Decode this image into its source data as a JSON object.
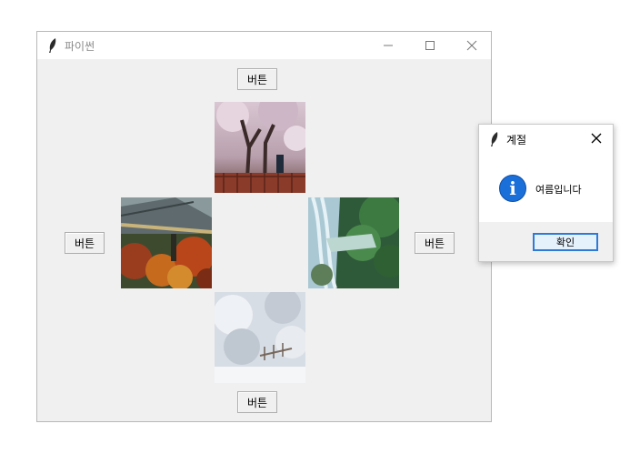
{
  "main_window": {
    "title": "파이썬",
    "buttons": {
      "top": "버튼",
      "left": "버튼",
      "right": "버튼",
      "bottom": "버튼"
    },
    "images": [
      "spring-cherry-blossom",
      "autumn-palace-foliage",
      "summer-waterfall",
      "winter-snow-forest"
    ],
    "controls": [
      "minimize-icon",
      "maximize-icon",
      "close-icon"
    ]
  },
  "dialog": {
    "title": "계절",
    "message": "여름입니다",
    "ok_label": "확인",
    "icon": "info-icon",
    "accent": "#1b6fd8"
  }
}
